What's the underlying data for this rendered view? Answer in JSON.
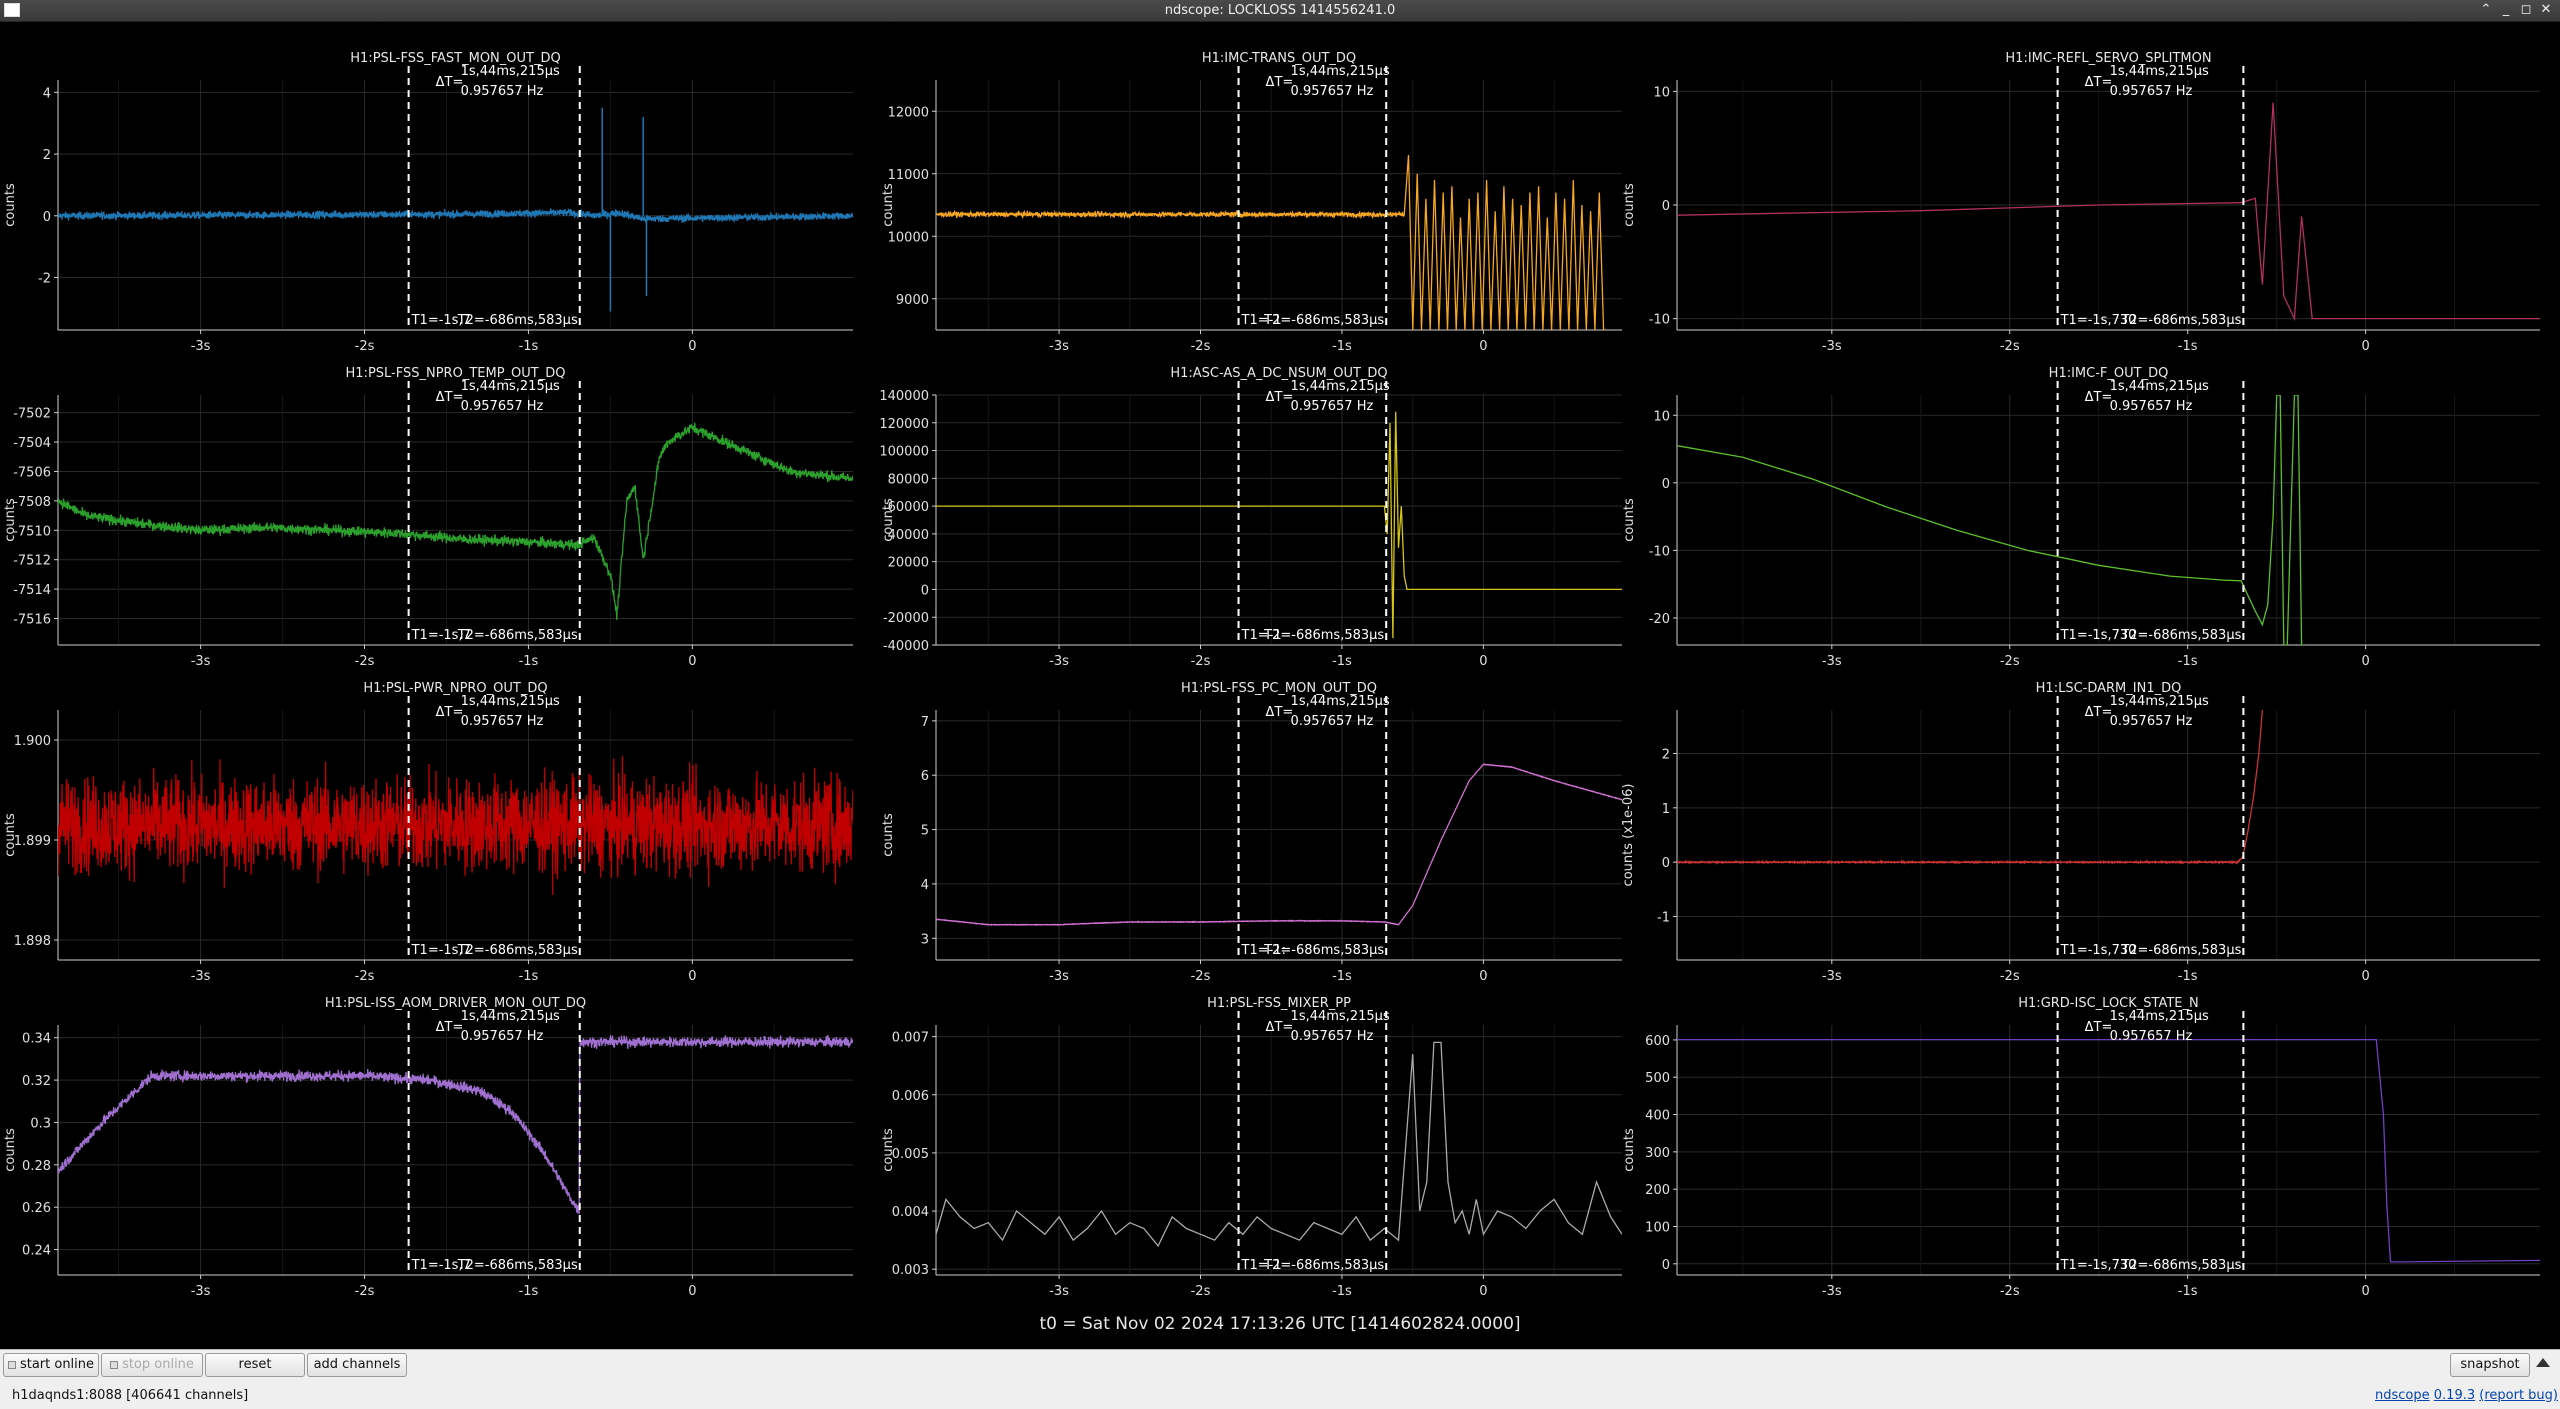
{
  "window": {
    "title": "ndscope: LOCKLOSS 1414556241.0"
  },
  "cursor": {
    "dt": "ΔT=",
    "dt_value": "1s,44ms,215µs",
    "freq": "0.957657 Hz",
    "t2": "T2=-686ms,583µs"
  },
  "t0_label": "t0 = Sat Nov 02 2024 17:13:26 UTC [1414602824.0000]",
  "toolbar": {
    "start_online": "start online",
    "stop_online": "stop online",
    "reset": "reset",
    "add_channels": "add channels",
    "snapshot": "snapshot",
    "status": "h1daqnds1:8088  [406641 channels]",
    "version_prefix": "ndscope",
    "version": "0.19.3",
    "report_bug": "(report bug)"
  },
  "colors": {
    "background": "#000000",
    "grid": "#2a2a2a",
    "axis": "#cfcfcf",
    "cursor": "#ffffff"
  },
  "chart_data": [
    {
      "type": "line",
      "title": "H1:PSL-FSS_FAST_MON_OUT_DQ",
      "ylabel": "counts",
      "xlabel": "",
      "color": "#1f77b4",
      "ylim": [
        -3.7,
        4.4
      ],
      "yticks": [
        4,
        2,
        0,
        -2
      ],
      "t1_label": "T1=-1s,7",
      "xlim": [
        -3.87,
        0.98
      ],
      "xticks": [
        -3,
        -2,
        -1,
        0
      ],
      "xtick_labels": [
        "-3s",
        "-2s",
        "-1s",
        "0"
      ],
      "cursors": [
        -1.731,
        -0.687
      ],
      "noise": 0.12,
      "shape": "noisy_flat_spikes",
      "series": [
        {
          "x": [
            -3.87,
            -1.5,
            -0.75,
            -0.6,
            -0.45,
            -0.3,
            0.98
          ],
          "y": [
            0,
            0.05,
            0.1,
            0,
            0.1,
            -0.1,
            0
          ],
          "spikes": [
            [
              -0.55,
              3.5
            ],
            [
              -0.5,
              -3.1
            ],
            [
              -0.3,
              3.2
            ],
            [
              -0.28,
              -2.6
            ]
          ]
        }
      ]
    },
    {
      "type": "line",
      "title": "H1:IMC-TRANS_OUT_DQ",
      "ylabel": "counts",
      "xlabel": "",
      "color": "#f5a623",
      "ylim": [
        8500,
        12500
      ],
      "yticks": [
        12000,
        11000,
        10000,
        9000
      ],
      "t1_label": "T1=-1",
      "xlim": [
        -3.87,
        0.98
      ],
      "xticks": [
        -3,
        -2,
        -1,
        0
      ],
      "xtick_labels": [
        "-3s",
        "-2s",
        "-1s",
        "0"
      ],
      "cursors": [
        -1.731,
        -0.687
      ],
      "noise": 40,
      "shape": "flat_then_pulses",
      "series": [
        {
          "x": [
            -3.87,
            -0.56
          ],
          "y": [
            10350,
            10350
          ],
          "pulse_start": -0.56,
          "pulse_end": 0.85,
          "pulse_low": 8500,
          "pulse_high": 11300
        }
      ]
    },
    {
      "type": "line",
      "title": "H1:IMC-REFL_SERVO_SPLITMON",
      "ylabel": "counts",
      "xlabel": "",
      "color": "#b03060",
      "ylim": [
        -11,
        11
      ],
      "yticks": [
        10,
        0,
        -10
      ],
      "t1_label": "T1=-1s,730",
      "xlim": [
        -3.87,
        0.98
      ],
      "xticks": [
        -3,
        -2,
        -1,
        0
      ],
      "xtick_labels": [
        "-3s",
        "-2s",
        "-1s",
        "0"
      ],
      "cursors": [
        -1.731,
        -0.687
      ],
      "noise": 0,
      "shape": "line",
      "series": [
        {
          "x": [
            -3.87,
            -2.5,
            -1.5,
            -0.7,
            -0.62,
            -0.58,
            -0.52,
            -0.46,
            -0.4,
            -0.36,
            -0.3,
            -0.25,
            -0.2,
            0.0,
            0.98
          ],
          "y": [
            -0.9,
            -0.5,
            0,
            0.2,
            0.6,
            -7,
            9,
            -8,
            -10,
            -1,
            -10,
            -10,
            -10,
            -10,
            -10
          ]
        }
      ]
    },
    {
      "type": "line",
      "title": "H1:PSL-FSS_NPRO_TEMP_OUT_DQ",
      "ylabel": "counts",
      "xlabel": "",
      "color": "#2ca02c",
      "ylim": [
        -7517.8,
        -7500.8
      ],
      "yticks": [
        -7502,
        -7504,
        -7506,
        -7508,
        -7510,
        -7512,
        -7514,
        -7516
      ],
      "t1_label": "T1=-1s,7",
      "xlim": [
        -3.87,
        0.98
      ],
      "xticks": [
        -3,
        -2,
        -1,
        0
      ],
      "xtick_labels": [
        "-3s",
        "-2s",
        "-1s",
        "0"
      ],
      "cursors": [
        -1.731,
        -0.687
      ],
      "noise": 0.35,
      "shape": "line",
      "series": [
        {
          "x": [
            -3.87,
            -3.7,
            -3.4,
            -3.0,
            -2.6,
            -2.2,
            -1.8,
            -1.4,
            -1.0,
            -0.7,
            -0.6,
            -0.5,
            -0.46,
            -0.4,
            -0.35,
            -0.3,
            -0.2,
            -0.15,
            0,
            0.3,
            0.6,
            0.98
          ],
          "y": [
            -7508,
            -7509,
            -7509.5,
            -7510,
            -7509.8,
            -7510,
            -7510.2,
            -7510.6,
            -7510.8,
            -7511,
            -7510.5,
            -7513,
            -7515.8,
            -7508,
            -7507,
            -7512,
            -7505,
            -7504,
            -7503,
            -7504.5,
            -7506,
            -7506.5
          ]
        }
      ]
    },
    {
      "type": "line",
      "title": "H1:ASC-AS_A_DC_NSUM_OUT_DQ",
      "ylabel": "counts",
      "xlabel": "",
      "color": "#d4c417",
      "ylim": [
        -40000,
        140000
      ],
      "yticks": [
        140000,
        120000,
        100000,
        80000,
        60000,
        40000,
        20000,
        0,
        -20000,
        -40000
      ],
      "t1_label": "T1=-1",
      "xlim": [
        -3.87,
        0.98
      ],
      "xticks": [
        -3,
        -2,
        -1,
        0
      ],
      "xtick_labels": [
        "-3s",
        "-2s",
        "-1s",
        "0"
      ],
      "cursors": [
        -1.731,
        -0.687
      ],
      "noise": 0,
      "shape": "line",
      "series": [
        {
          "x": [
            -3.87,
            -0.72,
            -0.7,
            -0.68,
            -0.66,
            -0.64,
            -0.62,
            -0.6,
            -0.58,
            -0.56,
            -0.54,
            -0.52,
            0.98
          ],
          "y": [
            60000,
            60000,
            60000,
            40000,
            120000,
            -35000,
            128000,
            30000,
            60000,
            10000,
            0,
            0,
            0
          ]
        }
      ]
    },
    {
      "type": "line",
      "title": "H1:IMC-F_OUT_DQ",
      "ylabel": "counts",
      "xlabel": "",
      "color": "#5cbf2a",
      "ylim": [
        -24,
        13
      ],
      "yticks": [
        10,
        0,
        -10,
        -20
      ],
      "t1_label": "T1=-1s,730",
      "xlim": [
        -3.87,
        0.98
      ],
      "xticks": [
        -3,
        -2,
        -1,
        0
      ],
      "xtick_labels": [
        "-3s",
        "-2s",
        "-1s",
        "0"
      ],
      "cursors": [
        -1.731,
        -0.687
      ],
      "noise": 0,
      "shape": "line",
      "series": [
        {
          "x": [
            -3.87,
            -3.5,
            -3.1,
            -2.7,
            -2.3,
            -1.9,
            -1.5,
            -1.1,
            -0.8,
            -0.7,
            -0.62,
            -0.58,
            -0.55,
            -0.52,
            -0.5,
            -0.48,
            -0.46,
            -0.44,
            -0.42,
            -0.4,
            -0.38,
            -0.36,
            -0.34
          ],
          "y": [
            5.5,
            3.8,
            0.5,
            -3.5,
            -7,
            -10,
            -12.2,
            -13.8,
            -14.4,
            -14.5,
            -19,
            -21,
            -18,
            -5,
            13,
            13,
            -24,
            -24,
            -5,
            13,
            13,
            -24,
            -24
          ]
        }
      ]
    },
    {
      "type": "line",
      "title": "H1:PSL-PWR_NPRO_OUT_DQ",
      "ylabel": "counts",
      "xlabel": "",
      "color": "#c00000",
      "ylim": [
        1.8978,
        1.9003
      ],
      "yticks": [
        1.9,
        1.899,
        1.898
      ],
      "ytick_labels": [
        "1.900",
        "1.899",
        "1.898"
      ],
      "t1_label": "T1=-1s,7",
      "xlim": [
        -3.87,
        0.98
      ],
      "xticks": [
        -3,
        -2,
        -1,
        0
      ],
      "xtick_labels": [
        "-3s",
        "-2s",
        "-1s",
        "0"
      ],
      "cursors": [
        -1.731,
        -0.687
      ],
      "noise": 0.00048,
      "shape": "line",
      "series": [
        {
          "x": [
            -3.87,
            0.98
          ],
          "y": [
            1.89915,
            1.89915
          ]
        }
      ]
    },
    {
      "type": "line",
      "title": "H1:PSL-FSS_PC_MON_OUT_DQ",
      "ylabel": "counts",
      "xlabel": "",
      "color": "#d070d0",
      "ylim": [
        2.6,
        7.2
      ],
      "yticks": [
        7,
        6,
        5,
        4,
        3
      ],
      "t1_label": "T1=-1:",
      "xlim": [
        -3.87,
        0.98
      ],
      "xticks": [
        -3,
        -2,
        -1,
        0
      ],
      "xtick_labels": [
        "-3s",
        "-2s",
        "-1s",
        "0"
      ],
      "cursors": [
        -1.731,
        -0.687
      ],
      "noise": 0.005,
      "shape": "line",
      "series": [
        {
          "x": [
            -3.87,
            -3.5,
            -3.0,
            -2.5,
            -2.0,
            -1.5,
            -1.0,
            -0.7,
            -0.6,
            -0.5,
            -0.3,
            -0.1,
            0.0,
            0.2,
            0.5,
            0.98
          ],
          "y": [
            3.35,
            3.25,
            3.25,
            3.3,
            3.3,
            3.32,
            3.32,
            3.3,
            3.25,
            3.6,
            4.8,
            5.9,
            6.2,
            6.15,
            5.9,
            5.55
          ]
        }
      ]
    },
    {
      "type": "line",
      "title": "H1:LSC-DARM_IN1_DQ",
      "ylabel": "counts (x1e-06)",
      "xlabel": "",
      "color": "#cc3333",
      "ylim": [
        -1.8,
        2.8
      ],
      "yticks": [
        2,
        1,
        0,
        -1
      ],
      "t1_label": "T1=-1s,730",
      "xlim": [
        -3.87,
        0.98
      ],
      "xticks": [
        -3,
        -2,
        -1,
        0
      ],
      "xtick_labels": [
        "-3s",
        "-2s",
        "-1s",
        "0"
      ],
      "cursors": [
        -1.731,
        -0.687
      ],
      "noise": 0.01,
      "shape": "line",
      "series": [
        {
          "x": [
            -3.87,
            -1.5,
            -0.72,
            -0.69,
            -0.66,
            -0.63,
            -0.6,
            -0.58
          ],
          "y": [
            0,
            0,
            0,
            0.1,
            0.6,
            1.2,
            2.0,
            2.8
          ]
        }
      ]
    },
    {
      "type": "line",
      "title": "H1:PSL-ISS_AOM_DRIVER_MON_OUT_DQ",
      "ylabel": "counts",
      "xlabel": "",
      "color": "#a070d0",
      "ylim": [
        0.228,
        0.346
      ],
      "yticks": [
        0.34,
        0.32,
        0.3,
        0.28,
        0.26,
        0.24
      ],
      "ytick_labels": [
        "0.34",
        "0.32",
        "0.3",
        "0.28",
        "0.26",
        "0.24"
      ],
      "t1_label": "T1=-1s,7",
      "xlim": [
        -3.87,
        0.98
      ],
      "xticks": [
        -3,
        -2,
        -1,
        0
      ],
      "xtick_labels": [
        "-3s",
        "-2s",
        "-1s",
        "0"
      ],
      "cursors": [
        -1.731,
        -0.687
      ],
      "noise": 0.0025,
      "shape": "line",
      "series": [
        {
          "x": [
            -3.87,
            -3.6,
            -3.3,
            -3.0,
            -2.5,
            -2.0,
            -1.6,
            -1.3,
            -1.1,
            -0.9,
            -0.75,
            -0.69,
            -0.687,
            0.98
          ],
          "y": [
            0.277,
            0.3,
            0.322,
            0.322,
            0.322,
            0.322,
            0.32,
            0.315,
            0.305,
            0.285,
            0.265,
            0.258,
            0.338,
            0.338
          ]
        }
      ]
    },
    {
      "type": "line",
      "title": "H1:PSL-FSS_MIXER_PP",
      "ylabel": "counts",
      "xlabel": "",
      "color": "#aaaaaa",
      "ylim": [
        0.0029,
        0.0072
      ],
      "yticks": [
        0.007,
        0.006,
        0.005,
        0.004,
        0.003
      ],
      "ytick_labels": [
        "0.007",
        "0.006",
        "0.005",
        "0.004",
        "0.003"
      ],
      "t1_label": "T1=-1",
      "xlim": [
        -3.87,
        0.98
      ],
      "xticks": [
        -3,
        -2,
        -1,
        0
      ],
      "xtick_labels": [
        "-3s",
        "-2s",
        "-1s",
        "0"
      ],
      "cursors": [
        -1.731,
        -0.687
      ],
      "noise": 0,
      "shape": "line",
      "series": [
        {
          "x": [
            -3.87,
            -3.8,
            -3.7,
            -3.6,
            -3.5,
            -3.4,
            -3.3,
            -3.2,
            -3.1,
            -3.0,
            -2.9,
            -2.8,
            -2.7,
            -2.6,
            -2.5,
            -2.4,
            -2.3,
            -2.2,
            -2.1,
            -2.0,
            -1.9,
            -1.8,
            -1.7,
            -1.6,
            -1.5,
            -1.4,
            -1.3,
            -1.2,
            -1.1,
            -1.0,
            -0.9,
            -0.8,
            -0.7,
            -0.6,
            -0.5,
            -0.45,
            -0.4,
            -0.35,
            -0.3,
            -0.25,
            -0.2,
            -0.15,
            -0.1,
            -0.05,
            0.0,
            0.1,
            0.2,
            0.3,
            0.4,
            0.5,
            0.6,
            0.7,
            0.8,
            0.9,
            0.98
          ],
          "y": [
            0.0036,
            0.0042,
            0.0039,
            0.0037,
            0.0038,
            0.0035,
            0.004,
            0.0038,
            0.0036,
            0.0039,
            0.0035,
            0.0037,
            0.004,
            0.0036,
            0.0038,
            0.0037,
            0.0034,
            0.0039,
            0.0037,
            0.0036,
            0.0035,
            0.0038,
            0.0036,
            0.0039,
            0.0037,
            0.0036,
            0.0035,
            0.0038,
            0.0037,
            0.0036,
            0.0039,
            0.0035,
            0.0037,
            0.0035,
            0.0067,
            0.004,
            0.0045,
            0.0069,
            0.0069,
            0.0045,
            0.0038,
            0.004,
            0.0036,
            0.0042,
            0.0036,
            0.004,
            0.0039,
            0.0037,
            0.004,
            0.0042,
            0.0038,
            0.0036,
            0.0045,
            0.0039,
            0.0036
          ]
        }
      ]
    },
    {
      "type": "line",
      "title": "H1:GRD-ISC_LOCK_STATE_N",
      "ylabel": "counts",
      "xlabel": "",
      "color": "#7040c0",
      "ylim": [
        -30,
        640
      ],
      "yticks": [
        600,
        500,
        400,
        300,
        200,
        100,
        0
      ],
      "t1_label": "T1=-1s,730",
      "xlim": [
        -3.87,
        0.98
      ],
      "xticks": [
        -3,
        -2,
        -1,
        0
      ],
      "xtick_labels": [
        "-3s",
        "-2s",
        "-1s",
        "0"
      ],
      "cursors": [
        -1.731,
        -0.687
      ],
      "noise": 0,
      "shape": "line",
      "series": [
        {
          "x": [
            -3.87,
            0.06,
            0.1,
            0.12,
            0.14,
            0.2,
            0.98
          ],
          "y": [
            601,
            601,
            400,
            150,
            5,
            5,
            9
          ]
        }
      ]
    }
  ]
}
